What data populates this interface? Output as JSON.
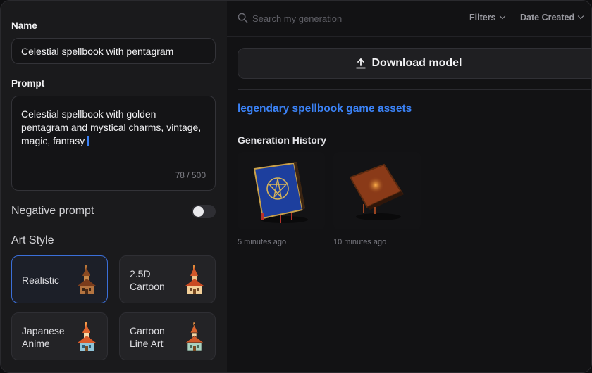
{
  "form": {
    "name_label": "Name",
    "name_value": "Celestial spellbook with pentagram",
    "prompt_label": "Prompt",
    "prompt_value": "Celestial spellbook with golden pentagram and mystical charms, vintage, magic, fantasy",
    "prompt_counter": "78 / 500",
    "negative_prompt_label": "Negative prompt",
    "negative_prompt_enabled": false,
    "art_style_label": "Art Style",
    "art_styles": [
      {
        "label": "Realistic",
        "icon": "house-icon",
        "selected": true
      },
      {
        "label": "2.5D\nCartoon",
        "icon": "house-icon",
        "selected": false
      },
      {
        "label": "Japanese\nAnime",
        "icon": "house-icon",
        "selected": false
      },
      {
        "label": "Cartoon\nLine Art",
        "icon": "house-icon",
        "selected": false
      }
    ]
  },
  "toolbar": {
    "search_placeholder": "Search my generation",
    "filters_label": "Filters",
    "sort_label": "Date Created"
  },
  "download": {
    "label": "Download model",
    "icon": "upload-icon"
  },
  "set_title": "legendary spellbook game assets",
  "history": {
    "label": "Generation History",
    "items": [
      {
        "time": "5 minutes ago",
        "icon": "blue-spellbook-thumbnail"
      },
      {
        "time": "10 minutes ago",
        "icon": "brown-spellbook-thumbnail"
      }
    ]
  },
  "colors": {
    "accent": "#3b82f6",
    "panel": "#1a1a1c",
    "background": "#121214"
  }
}
